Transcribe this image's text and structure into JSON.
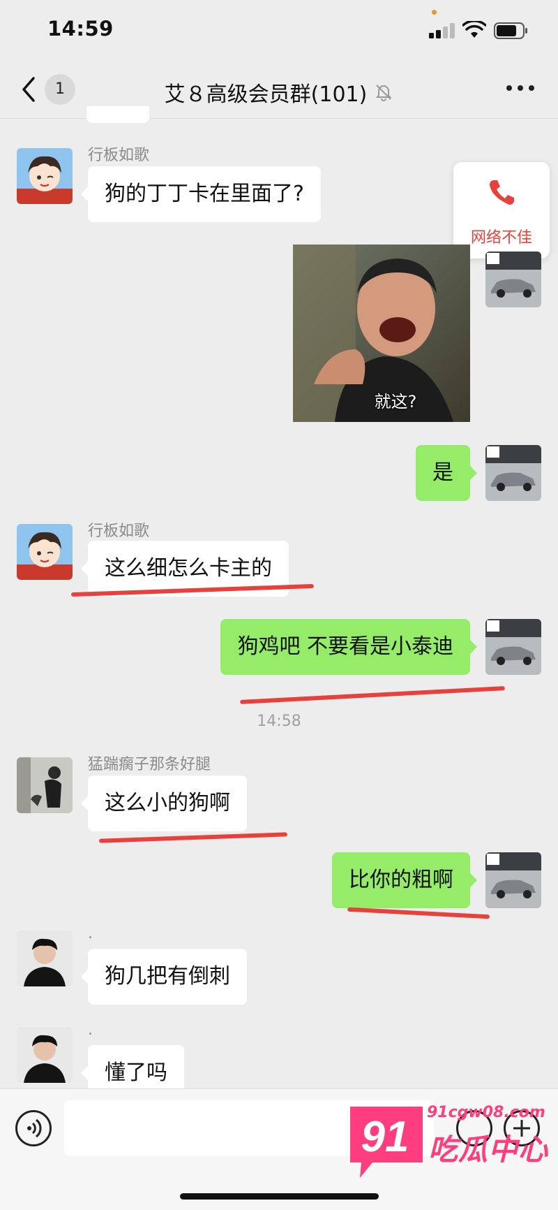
{
  "status_bar": {
    "time": "14:59"
  },
  "nav": {
    "back_badge": "1",
    "title": "艾８高级会员群(101)"
  },
  "call_float": {
    "label": "网络不佳"
  },
  "messages": [
    {
      "sender": "行板如歌",
      "text": "狗的丁丁卡在里面了?"
    },
    {
      "caption": "就这?"
    },
    {
      "text": "是"
    },
    {
      "sender": "行板如歌",
      "text": "这么细怎么卡主的"
    },
    {
      "text": "狗鸡吧 不要看是小泰迪"
    },
    {
      "timestamp": "14:58"
    },
    {
      "sender": "猛踹瘸子那条好腿",
      "text": "这么小的狗啊"
    },
    {
      "text": "比你的粗啊"
    },
    {
      "sender": ".",
      "text": "狗几把有倒刺"
    },
    {
      "sender": ".",
      "text": "懂了吗"
    }
  ],
  "watermark": {
    "url": "91cgw08.com",
    "logo": "91",
    "name": "吃瓜中心"
  },
  "colors": {
    "background": "#ededed",
    "outgoing_bubble": "#95ec69",
    "incoming_bubble": "#ffffff",
    "annotation_red": "#e8413c",
    "watermark_pink": "#ff3d7f"
  }
}
